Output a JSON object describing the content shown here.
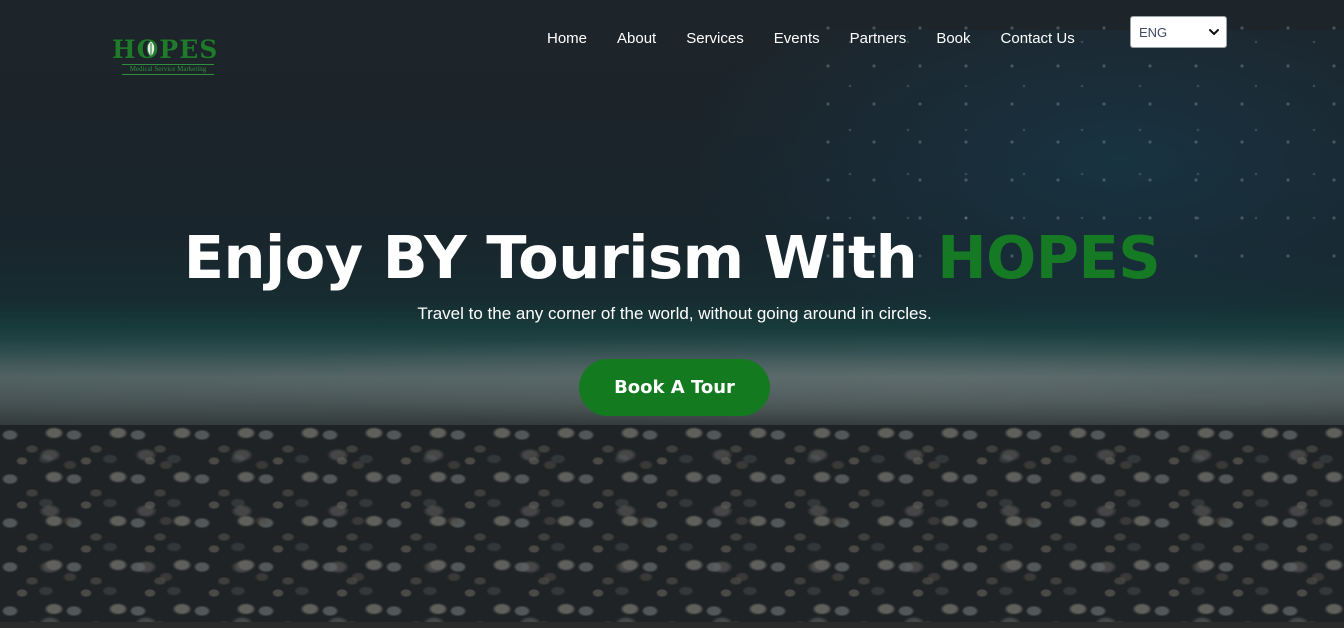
{
  "logo": {
    "word": "HOPES",
    "tagline": "Medical Service Marketing"
  },
  "nav": {
    "items": [
      "Home",
      "About",
      "Services",
      "Events",
      "Partners",
      "Book",
      "Contact Us"
    ]
  },
  "language_select": {
    "value": "ENG",
    "icon": "chevron-down-icon"
  },
  "hero": {
    "headline_prefix": "Enjoy BY Tourism With ",
    "headline_brand": "HOPES",
    "subheadline": "Travel to the any corner of the world, without going around in circles.",
    "cta_label": "Book A Tour"
  },
  "colors": {
    "brand_green": "#167a24",
    "button_green": "#137a20",
    "nav_text": "#ffffff"
  }
}
